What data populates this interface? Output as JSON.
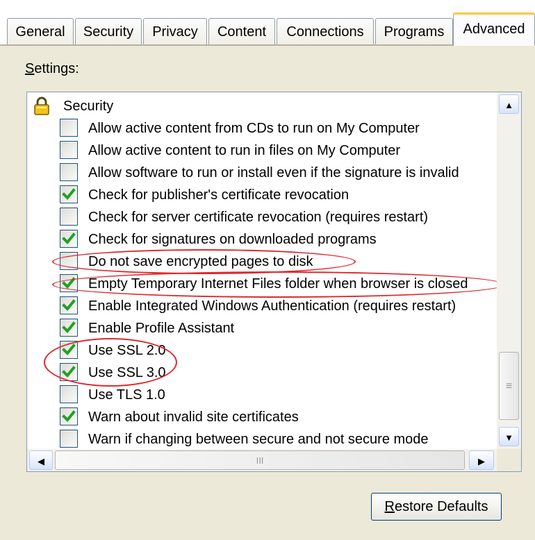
{
  "tabs": [
    {
      "label": "General"
    },
    {
      "label": "Security"
    },
    {
      "label": "Privacy"
    },
    {
      "label": "Content"
    },
    {
      "label": "Connections"
    },
    {
      "label": "Programs"
    },
    {
      "label": "Advanced",
      "active": true
    }
  ],
  "settings_label": {
    "mnemonic": "S",
    "rest": "ettings:"
  },
  "tree": {
    "group": {
      "label": "Security",
      "icon": "lock-icon"
    },
    "items": [
      {
        "label": "Allow active content from CDs to run on My Computer",
        "checked": false
      },
      {
        "label": "Allow active content to run in files on My Computer",
        "checked": false
      },
      {
        "label": "Allow software to run or install even if the signature is invalid",
        "checked": false
      },
      {
        "label": "Check for publisher's certificate revocation",
        "checked": true
      },
      {
        "label": "Check for server certificate revocation (requires restart)",
        "checked": false
      },
      {
        "label": "Check for signatures on downloaded programs",
        "checked": true
      },
      {
        "label": "Do not save encrypted pages to disk",
        "checked": false,
        "highlighted": true
      },
      {
        "label": "Empty Temporary Internet Files folder when browser is closed",
        "checked": true,
        "highlighted": true
      },
      {
        "label": "Enable Integrated Windows Authentication (requires restart)",
        "checked": true
      },
      {
        "label": "Enable Profile Assistant",
        "checked": true
      },
      {
        "label": "Use SSL 2.0",
        "checked": true,
        "highlighted": true
      },
      {
        "label": "Use SSL 3.0",
        "checked": true,
        "highlighted": true
      },
      {
        "label": "Use TLS 1.0",
        "checked": false
      },
      {
        "label": "Warn about invalid site certificates",
        "checked": true
      },
      {
        "label": "Warn if changing between secure and not secure mode",
        "checked": false
      }
    ]
  },
  "scrollbars": {
    "up": "▲",
    "down": "▼",
    "left": "◀",
    "right": "▶",
    "vgrip": "≡",
    "hgrip": "III"
  },
  "restore_button": {
    "mnemonic": "R",
    "rest": "estore Defaults"
  },
  "colors": {
    "highlight_ellipse": "#e0282d",
    "checkmark": "#21a121",
    "tab_accent": "#ffc83c"
  }
}
